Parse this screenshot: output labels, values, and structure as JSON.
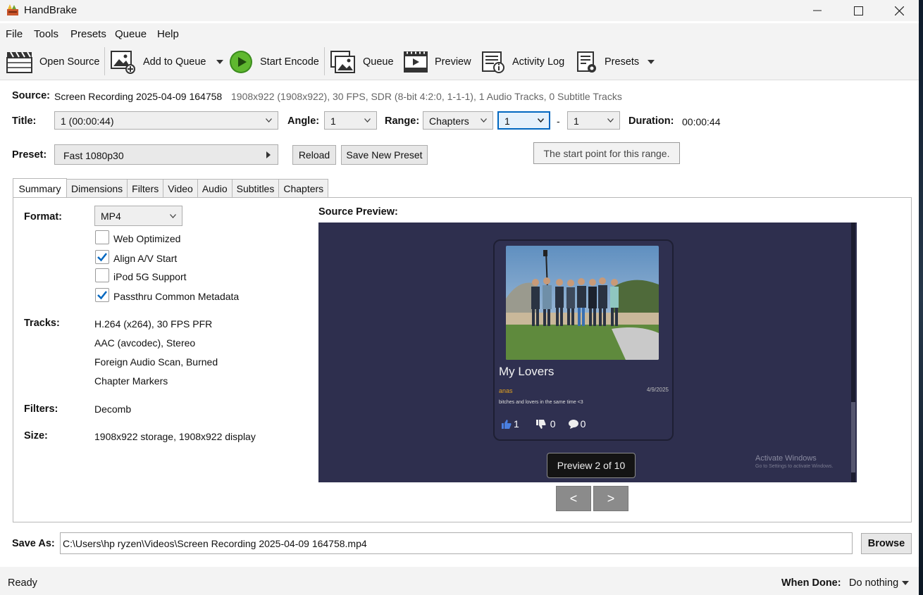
{
  "window": {
    "title": "HandBrake"
  },
  "menu": [
    "File",
    "Tools",
    "Presets",
    "Queue",
    "Help"
  ],
  "toolbar": {
    "open_source": "Open Source",
    "add_to_queue": "Add to Queue",
    "start_encode": "Start Encode",
    "queue": "Queue",
    "preview": "Preview",
    "activity_log": "Activity Log",
    "presets": "Presets"
  },
  "source": {
    "label": "Source:",
    "name": "Screen Recording 2025-04-09 164758",
    "info": "1908x922 (1908x922), 30 FPS, SDR (8-bit 4:2:0, 1-1-1), 1 Audio Tracks, 0 Subtitle Tracks"
  },
  "title_row": {
    "title_label": "Title:",
    "title_value": "1  (00:00:44)",
    "angle_label": "Angle:",
    "angle_value": "1",
    "range_label": "Range:",
    "range_type": "Chapters",
    "range_start": "1",
    "range_dash": "-",
    "range_end": "1",
    "duration_label": "Duration:",
    "duration_value": "00:00:44"
  },
  "preset_row": {
    "label": "Preset:",
    "value": "Fast 1080p30",
    "reload": "Reload",
    "save_new": "Save New Preset"
  },
  "tooltip": "The start point for this range.",
  "tabs": [
    "Summary",
    "Dimensions",
    "Filters",
    "Video",
    "Audio",
    "Subtitles",
    "Chapters"
  ],
  "summary": {
    "format_label": "Format:",
    "format_value": "MP4",
    "options": [
      {
        "label": "Web Optimized",
        "checked": false
      },
      {
        "label": "Align A/V Start",
        "checked": true
      },
      {
        "label": "iPod 5G Support",
        "checked": false
      },
      {
        "label": "Passthru Common Metadata",
        "checked": true
      }
    ],
    "tracks_label": "Tracks:",
    "tracks": [
      "H.264 (x264), 30 FPS PFR",
      "AAC (avcodec), Stereo",
      "Foreign Audio Scan, Burned",
      "Chapter Markers"
    ],
    "filters_label": "Filters:",
    "filters_value": "Decomb",
    "size_label": "Size:",
    "size_value": "1908x922 storage, 1908x922 display"
  },
  "source_preview": {
    "label": "Source Preview:",
    "card_title": "My Lovers",
    "card_author": "anas",
    "card_date": "4/9/2025",
    "card_desc": "bitches and lovers in the same time <3",
    "likes": "1",
    "dislikes": "0",
    "comments": "0",
    "watermark_line1": "Activate Windows",
    "watermark_line2": "Go to Settings to activate Windows.",
    "badge": "Preview 2 of 10",
    "prev": "<",
    "next": ">"
  },
  "save_as": {
    "label": "Save As:",
    "path": "C:\\Users\\hp ryzen\\Videos\\Screen Recording 2025-04-09 164758.mp4",
    "browse": "Browse"
  },
  "status": {
    "text": "Ready",
    "when_done_label": "When Done:",
    "when_done_value": "Do nothing"
  },
  "colors": {
    "accent": "#0067c0",
    "preview_bg": "#2e2f4e",
    "author": "#e0a020",
    "like_icon": "#4a7fe0"
  }
}
